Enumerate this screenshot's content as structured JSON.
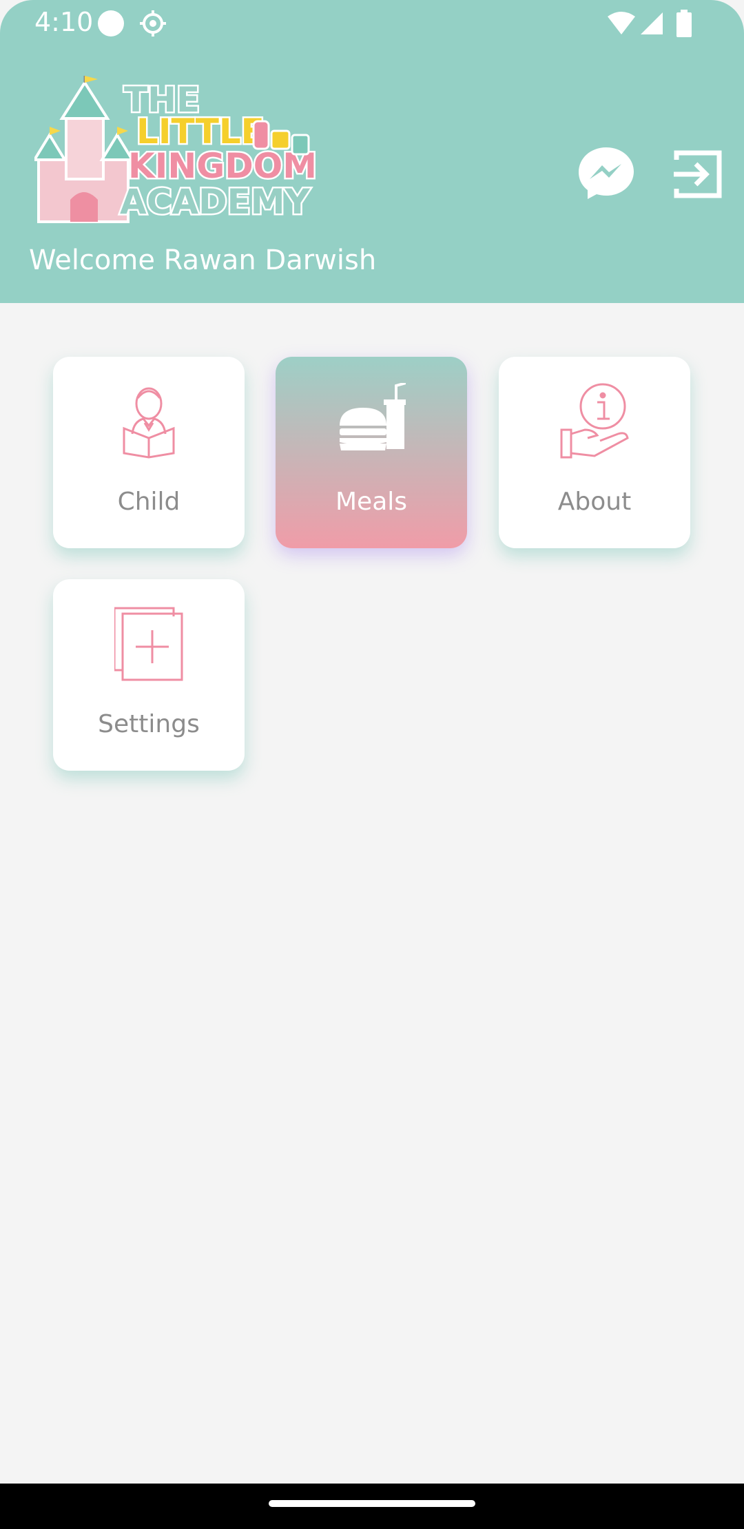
{
  "status_bar": {
    "time": "4:10",
    "icons": [
      "dot-icon",
      "settings-gear-icon",
      "wifi-icon",
      "signal-icon",
      "battery-icon"
    ]
  },
  "header": {
    "logo_text": "THE LITTLE KINGDOM ACADEMY",
    "welcome": "Welcome Rawan Darwish",
    "actions": [
      "messenger-icon",
      "logout-icon"
    ]
  },
  "menu": {
    "tiles": [
      {
        "label": "Child",
        "icon": "child-reading-icon",
        "active": false
      },
      {
        "label": "Meals",
        "icon": "burger-drink-icon",
        "active": true
      },
      {
        "label": "About",
        "icon": "info-hand-icon",
        "active": false
      },
      {
        "label": "Settings",
        "icon": "add-pages-icon",
        "active": false
      }
    ]
  },
  "colors": {
    "header_bg": "#94d0c5",
    "accent_pink": "#f09ca8",
    "page_bg": "#f4f4f4",
    "label_gray": "#8c8c8c"
  }
}
